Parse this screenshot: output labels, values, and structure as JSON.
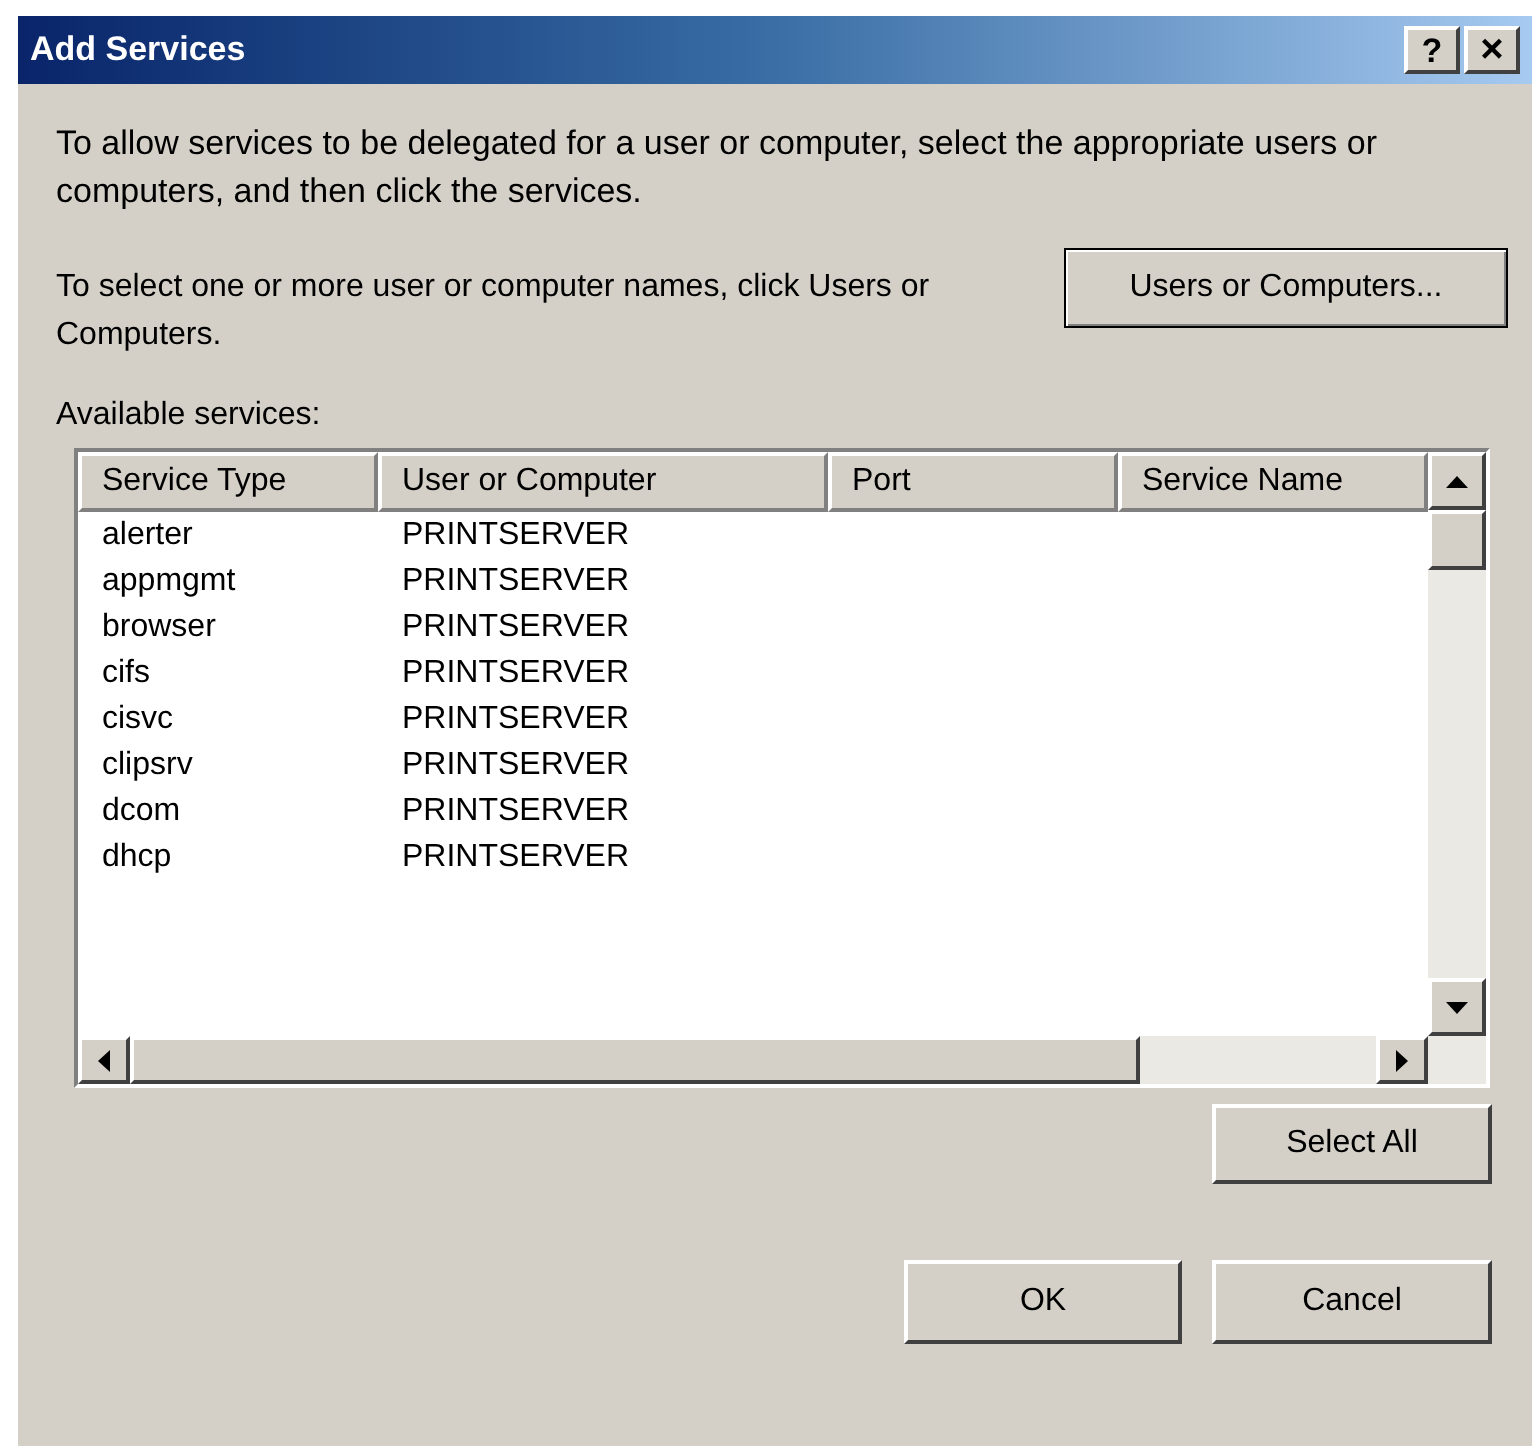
{
  "window": {
    "title": "Add Services",
    "help_button": "?",
    "close_button": "×"
  },
  "intro": "To allow services to be delegated for a user or computer, select the appropriate users or computers, and then click the services.",
  "select_hint": "To select one or more user or computer names, click Users or Computers.",
  "users_button": "Users or Computers...",
  "list_label": "Available services:",
  "table": {
    "columns": [
      "Service Type",
      "User or Computer",
      "Port",
      "Service Name"
    ],
    "rows": [
      {
        "service_type": "alerter",
        "user_or_computer": "PRINTSERVER"
      },
      {
        "service_type": "appmgmt",
        "user_or_computer": "PRINTSERVER"
      },
      {
        "service_type": "browser",
        "user_or_computer": "PRINTSERVER"
      },
      {
        "service_type": "cifs",
        "user_or_computer": "PRINTSERVER"
      },
      {
        "service_type": "cisvc",
        "user_or_computer": "PRINTSERVER"
      },
      {
        "service_type": "clipsrv",
        "user_or_computer": "PRINTSERVER"
      },
      {
        "service_type": "dcom",
        "user_or_computer": "PRINTSERVER"
      },
      {
        "service_type": "dhcp",
        "user_or_computer": "PRINTSERVER"
      }
    ]
  },
  "buttons": {
    "select_all": "Select All",
    "ok": "OK",
    "cancel": "Cancel"
  }
}
